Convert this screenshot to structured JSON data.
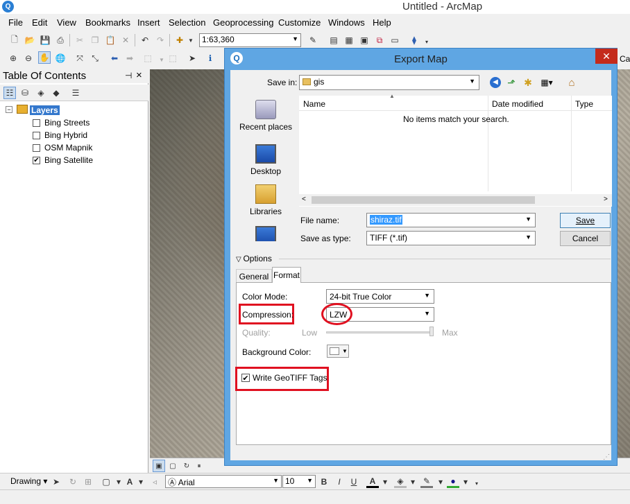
{
  "app": {
    "title": "Untitled - ArcMap",
    "logo": "Q"
  },
  "menu": [
    "File",
    "Edit",
    "View",
    "Bookmarks",
    "Insert",
    "Selection",
    "Geoprocessing",
    "Customize",
    "Windows",
    "Help"
  ],
  "toolbar": {
    "scale": "1:63,360"
  },
  "toc": {
    "title": "Table Of Contents",
    "pin": "ᵖ",
    "close": "×",
    "root": "Layers",
    "layers": [
      {
        "name": "Bing Streets",
        "checked": false
      },
      {
        "name": "Bing Hybrid",
        "checked": false
      },
      {
        "name": "OSM Mapnik",
        "checked": false
      },
      {
        "name": "Bing Satellite",
        "checked": true
      }
    ]
  },
  "map_edge_label": "Car",
  "dialog": {
    "title": "Export Map",
    "close": "✕",
    "save_in_label": "Save in:",
    "save_in_value": "gis",
    "places": [
      "Recent places",
      "Desktop",
      "Libraries"
    ],
    "columns": [
      "Name",
      "Date modified",
      "Type"
    ],
    "empty_message": "No items match your search.",
    "file_name_label": "File name:",
    "file_name_value": "shiraz.tif",
    "save_as_type_label": "Save as type:",
    "save_as_type_value": "TIFF (*.tif)",
    "save_button": "Save",
    "cancel_button": "Cancel",
    "options_label": "Options",
    "tabs": [
      "General",
      "Format"
    ],
    "active_tab": "Format",
    "color_mode_label": "Color Mode:",
    "color_mode_value": "24-bit True Color",
    "compression_label": "Compression:",
    "compression_value": "LZW",
    "quality_label": "Quality:",
    "quality_low": "Low",
    "quality_max": "Max",
    "background_color_label": "Background Color:",
    "geotiff_label": "Write GeoTIFF Tags",
    "geotiff_checked": true
  },
  "drawing": {
    "label": "Drawing",
    "font": "Arial",
    "font_size": "10",
    "bold": "B",
    "italic": "I",
    "underline": "U"
  },
  "colors": {
    "highlight": "#e01020",
    "dialog_border": "#5fa6e3",
    "close_button": "#c42b1c"
  }
}
